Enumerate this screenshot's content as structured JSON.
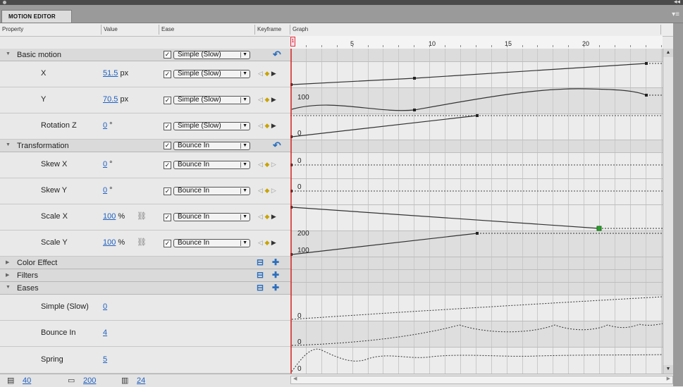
{
  "panel": {
    "tab_label": "MOTION EDITOR"
  },
  "columns": {
    "property": "Property",
    "value": "Value",
    "ease": "Ease",
    "keyframe": "Keyframe",
    "graph": "Graph"
  },
  "ruler": {
    "labels": [
      "5",
      "10",
      "15",
      "20"
    ],
    "current_frame": "1"
  },
  "sections": {
    "basic_motion": {
      "label": "Basic motion",
      "ease": "Simple (Slow)"
    },
    "transformation": {
      "label": "Transformation",
      "ease": "Bounce In"
    },
    "color_effect": {
      "label": "Color Effect"
    },
    "filters": {
      "label": "Filters"
    },
    "eases": {
      "label": "Eases"
    }
  },
  "properties": [
    {
      "name": "X",
      "value": "51.5",
      "unit": " px",
      "ease": "Simple (Slow)"
    },
    {
      "name": "Y",
      "value": "70.5",
      "unit": " px",
      "ease": "Simple (Slow)"
    },
    {
      "name": "Rotation Z",
      "value": "0",
      "unit": " °",
      "ease": "Simple (Slow)"
    },
    {
      "name": "Skew X",
      "value": "0",
      "unit": " °",
      "ease": "Bounce In"
    },
    {
      "name": "Skew Y",
      "value": "0",
      "unit": " °",
      "ease": "Bounce In"
    },
    {
      "name": "Scale X",
      "value": "100",
      "unit": " %",
      "ease": "Bounce In"
    },
    {
      "name": "Scale Y",
      "value": "100",
      "unit": " %",
      "ease": "Bounce In"
    }
  ],
  "eases": [
    {
      "name": "Simple (Slow)",
      "value": "0"
    },
    {
      "name": "Bounce In",
      "value": "4"
    },
    {
      "name": "Spring",
      "value": "5"
    }
  ],
  "graph_labels": {
    "y_value": "100",
    "rotation": "0",
    "skew_x": "0",
    "skew_y": "0",
    "scale_x": "200",
    "scale_y": "100",
    "ease_simple": "0",
    "ease_bounce": "0",
    "ease_spring": "0"
  },
  "bottom": {
    "row_height": "40",
    "graph_size": "200",
    "viewable_frames": "24"
  },
  "icons": {
    "checkbox": "checkmark-icon",
    "reset": "reset-values-icon",
    "add": "add-item-icon",
    "remove": "remove-item-icon",
    "prev_kf": "previous-keyframe-icon",
    "add_kf": "add-keyframe-icon",
    "next_kf": "next-keyframe-icon",
    "link": "link-values-icon"
  },
  "colors": {
    "playhead": "#d42020",
    "link": "#1f5fbf",
    "keyframe_selected": "#2aa32a"
  }
}
